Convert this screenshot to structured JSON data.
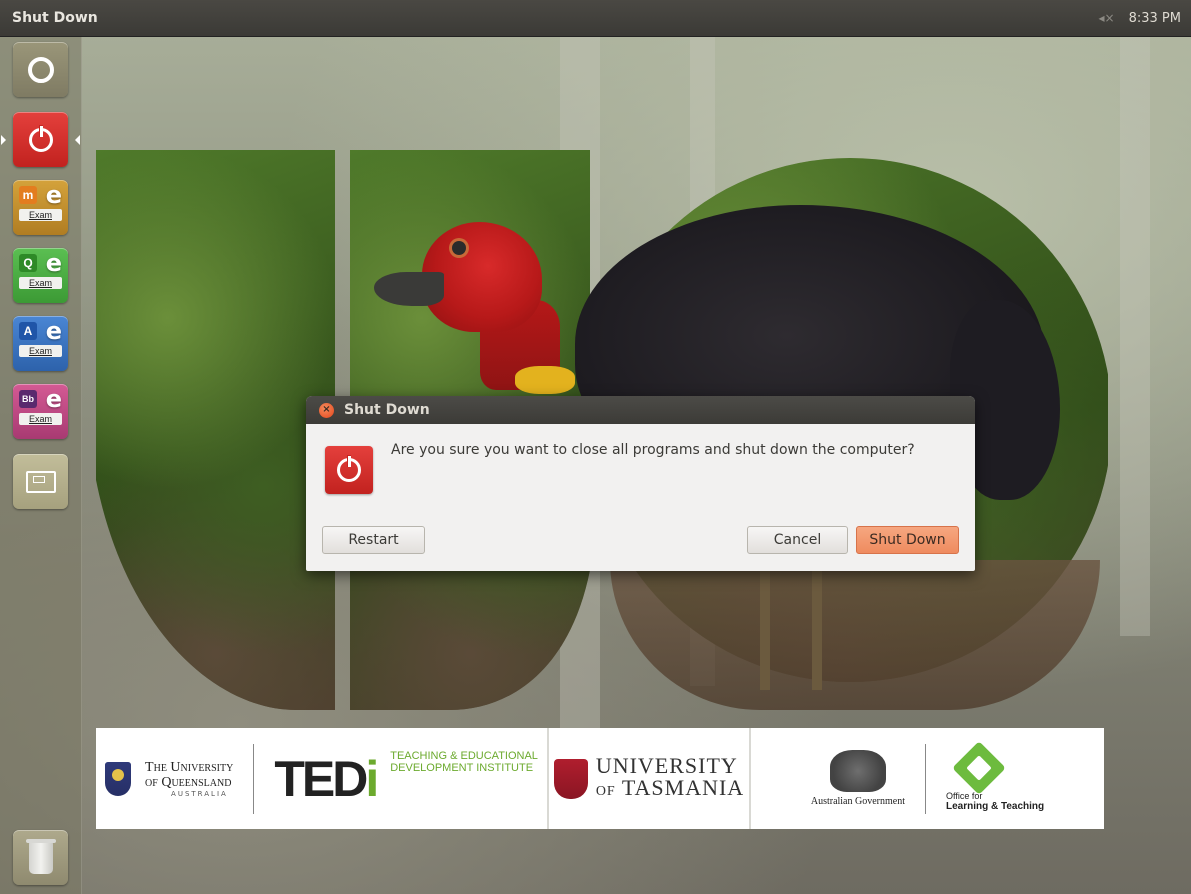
{
  "panel": {
    "title": "Shut Down",
    "volume_icon": "◂×",
    "time": "8:33 PM"
  },
  "launcher": {
    "items": [
      {
        "name": "dash-home",
        "icon": "ubuntu-logo-icon"
      },
      {
        "name": "shutdown",
        "icon": "power-icon",
        "active": true
      },
      {
        "name": "moodle-exam",
        "badge": "m",
        "letter": "e",
        "label": "Exam",
        "color": "#d4a23b"
      },
      {
        "name": "quiz-exam",
        "badge": "Q",
        "letter": "e",
        "label": "Exam",
        "color": "#5bbf52"
      },
      {
        "name": "assess-exam",
        "badge": "A",
        "letter": "e",
        "label": "Exam",
        "color": "#4a86d4"
      },
      {
        "name": "blackboard-exam",
        "badge": "Bb",
        "letter": "e",
        "label": "Exam",
        "color": "#d45a94"
      },
      {
        "name": "workspace-switcher",
        "icon": "workspace-icon"
      },
      {
        "name": "trash",
        "icon": "trash-icon"
      }
    ]
  },
  "dialog": {
    "title": "Shut Down",
    "message": "Are you sure you want to close all programs and shut down the computer?",
    "buttons": {
      "restart": "Restart",
      "cancel": "Cancel",
      "shutdown": "Shut Down"
    }
  },
  "logos": {
    "uq": {
      "line1": "The University",
      "line2": "of Queensland",
      "line3": "AUSTRALIA"
    },
    "tedi": {
      "mark_a": "TED",
      "mark_b": "i",
      "line1": "TEACHING & EDUCATIONAL",
      "line2": "DEVELOPMENT INSTITUTE"
    },
    "utas": {
      "line1": "UNIVERSITY",
      "of": "OF",
      "line2": "TASMANIA"
    },
    "govt": {
      "text": "Australian Government"
    },
    "olt": {
      "line1": "Office for",
      "line2": "Learning & Teaching"
    }
  },
  "colors": {
    "accent_orange": "#ef8b5f",
    "power_red": "#c2221f",
    "panel_dark": "#3c3b37"
  }
}
